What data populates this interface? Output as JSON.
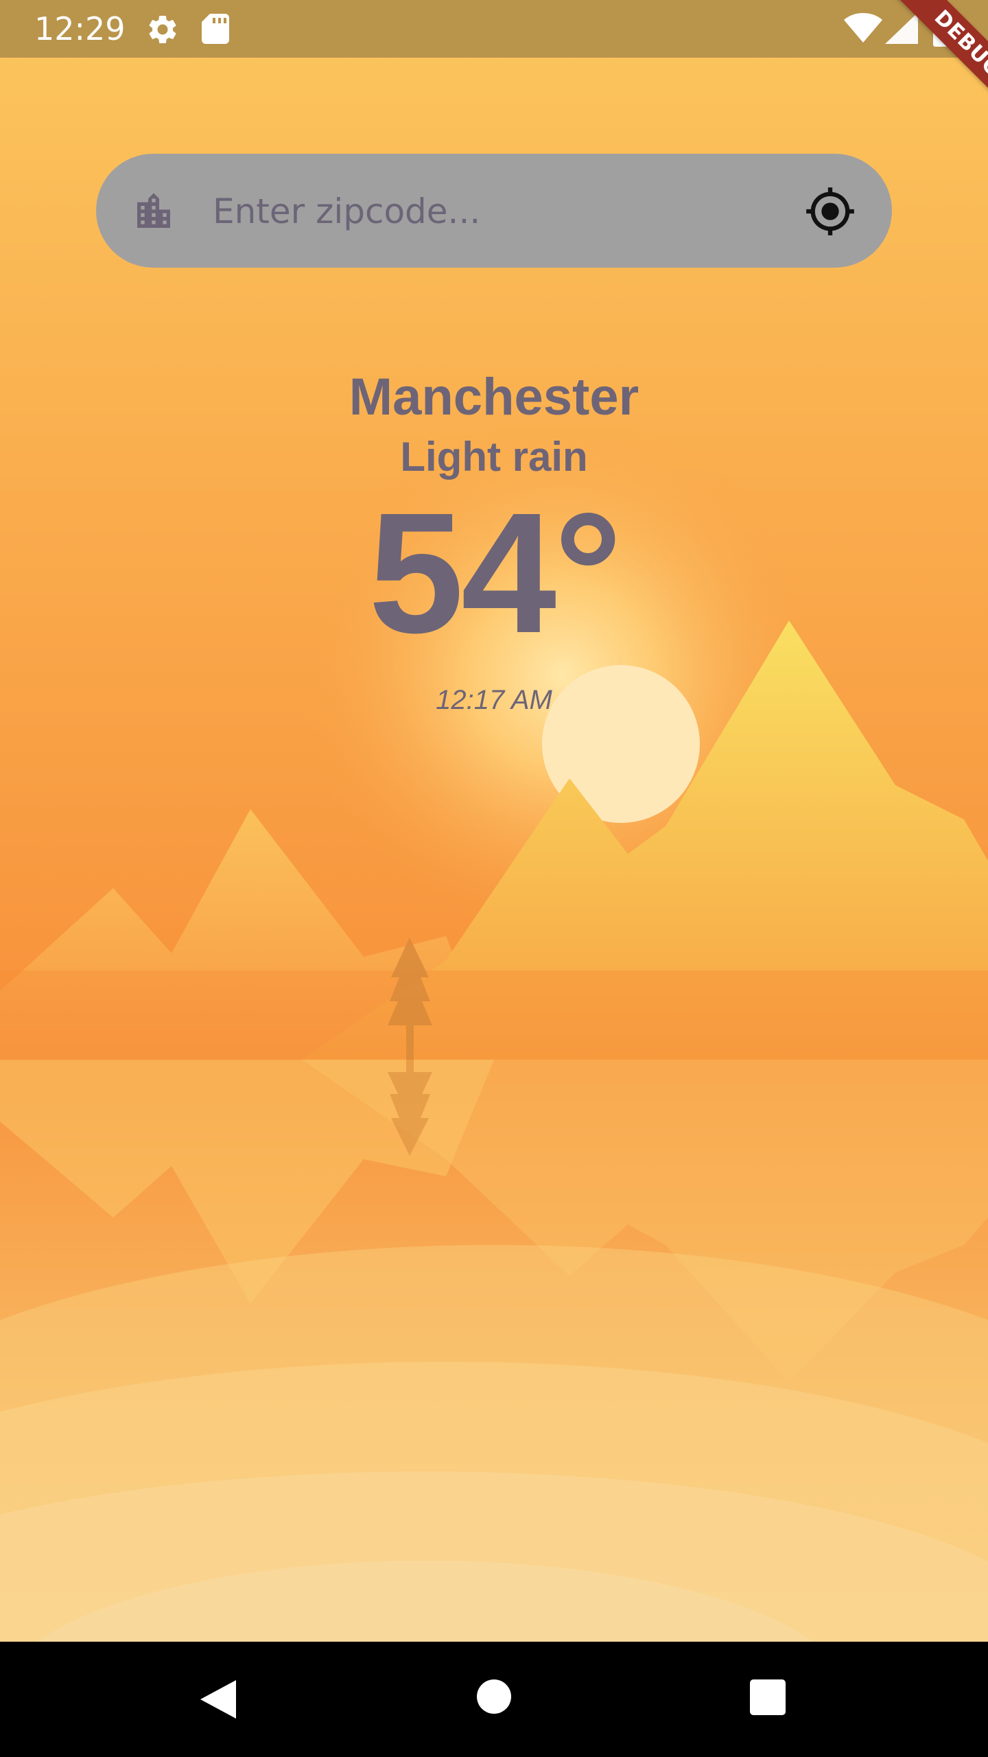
{
  "status_bar": {
    "time": "12:29",
    "icons": [
      "settings-icon",
      "sd-card-icon",
      "wifi-icon",
      "cell-signal-icon",
      "battery-charging-icon"
    ]
  },
  "debug_banner": "DEBUG",
  "search": {
    "placeholder": "Enter zipcode...",
    "value": "",
    "left_icon": "city-icon",
    "right_icon": "my-location-icon"
  },
  "weather": {
    "city": "Manchester",
    "condition": "Light rain",
    "temperature": "54°",
    "updated_time": "12:17 AM"
  },
  "nav_bar": {
    "icons": [
      "back-icon",
      "home-icon",
      "recents-icon"
    ]
  },
  "colors": {
    "status_bar": "#b9944b",
    "sky_top": "#fbc35c",
    "sky_horizon": "#f7953c",
    "text": "#6d6477",
    "search_bg": "#a1a0a1",
    "debug_ribbon": "#9c2f24"
  }
}
